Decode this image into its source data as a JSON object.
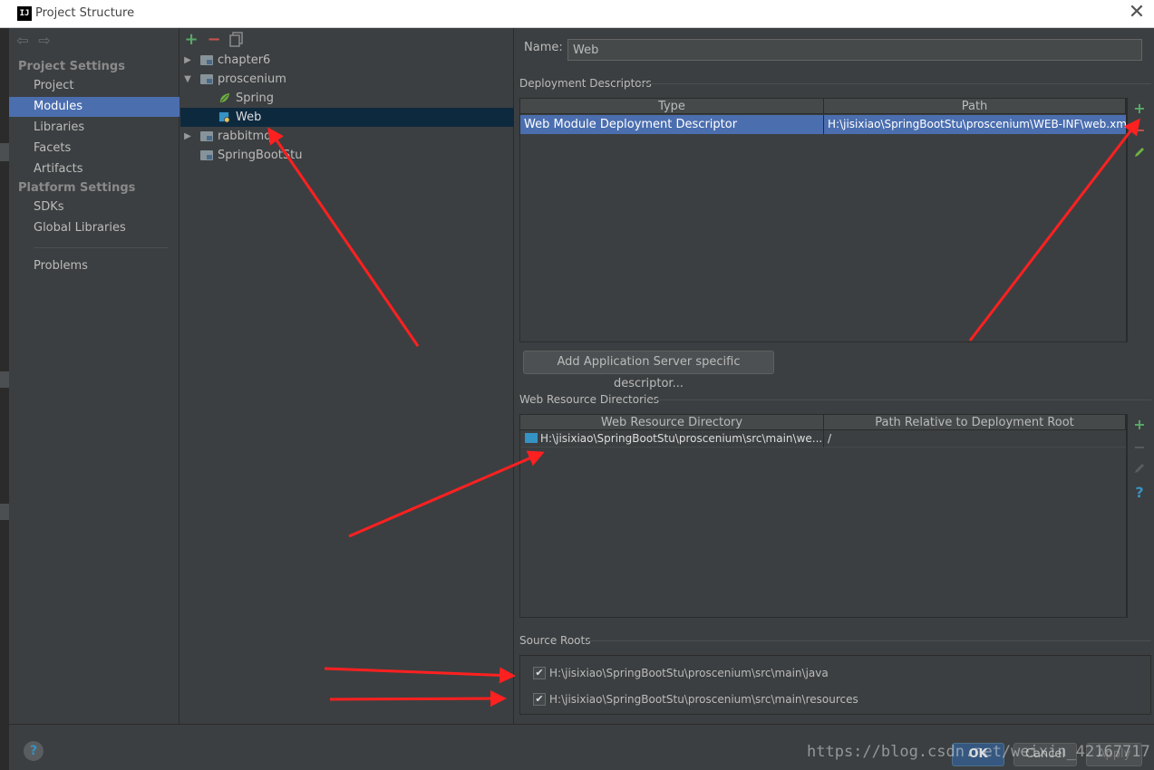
{
  "window": {
    "title": "Project Structure",
    "app_icon_text": "IJ",
    "close_glyph": "✕"
  },
  "sidebar": {
    "project_settings_header": "Project Settings",
    "platform_settings_header": "Platform Settings",
    "items": [
      {
        "label": "Project"
      },
      {
        "label": "Modules"
      },
      {
        "label": "Libraries"
      },
      {
        "label": "Facets"
      },
      {
        "label": "Artifacts"
      },
      {
        "label": "SDKs"
      },
      {
        "label": "Global Libraries"
      },
      {
        "label": "Problems"
      }
    ],
    "selected": "Modules"
  },
  "tree": {
    "toolbar": {
      "add": "+",
      "remove": "−",
      "copy": "copy-icon"
    },
    "nodes": [
      {
        "label": "chapter6",
        "expanded": false
      },
      {
        "label": "proscenium",
        "expanded": true
      },
      {
        "label": "Spring"
      },
      {
        "label": "Web",
        "selected": true
      },
      {
        "label": "rabbitmq",
        "expanded": false
      },
      {
        "label": "SpringBootStu"
      }
    ]
  },
  "facet": {
    "name_label": "Name:",
    "name_value": "Web",
    "deployment_descriptors": {
      "title": "Deployment Descriptors",
      "columns": [
        "Type",
        "Path"
      ],
      "rows": [
        {
          "type": "Web Module Deployment Descriptor",
          "path": "H:\\jisixiao\\SpringBootStu\\proscenium\\WEB-INF\\web.xml"
        }
      ]
    },
    "add_server_button": "Add Application Server specific descriptor...",
    "web_resource": {
      "title": "Web Resource Directories",
      "columns": [
        "Web Resource Directory",
        "Path Relative to Deployment Root"
      ],
      "rows": [
        {
          "directory": "H:\\jisixiao\\SpringBootStu\\proscenium\\src\\main\\we...",
          "relative": "/"
        }
      ]
    },
    "source_roots": {
      "title": "Source Roots",
      "items": [
        {
          "path": "H:\\jisixiao\\SpringBootStu\\proscenium\\src\\main\\java",
          "checked": true
        },
        {
          "path": "H:\\jisixiao\\SpringBootStu\\proscenium\\src\\main\\resources",
          "checked": true
        }
      ]
    }
  },
  "buttons": {
    "ok": "OK",
    "cancel": "Cancel",
    "apply": "Apply",
    "help": "?"
  },
  "watermark": "https://blog.csdn.net/weixin_42167717",
  "colors": {
    "selection": "#4b6eaf",
    "tree_selection": "#0d293e",
    "add_green": "#59a869",
    "remove_red": "#c75450",
    "annotation_red": "#ff2020"
  }
}
